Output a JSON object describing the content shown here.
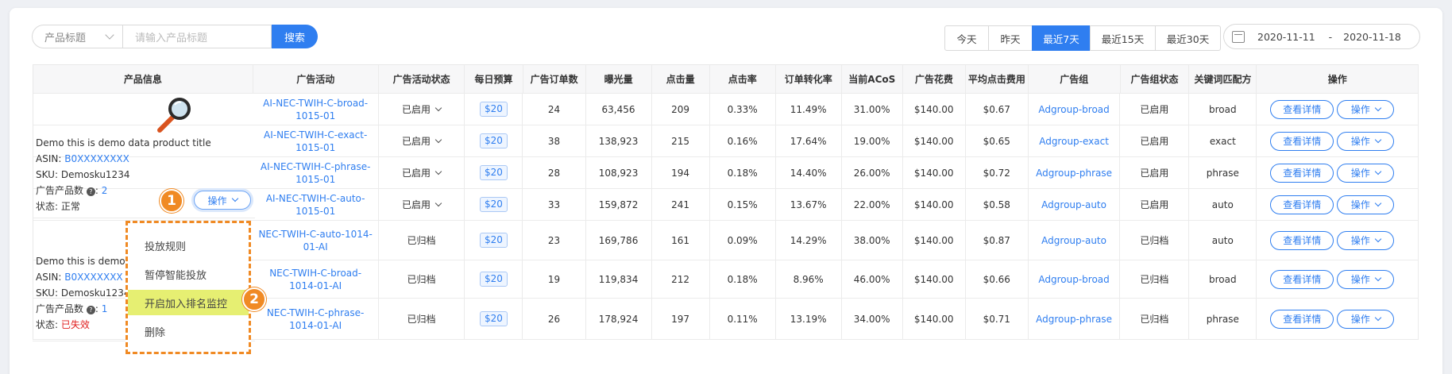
{
  "search": {
    "select_label": "产品标题",
    "input_placeholder": "请输入产品标题",
    "button_label": "搜索"
  },
  "date_tabs": [
    {
      "label": "今天",
      "active": false
    },
    {
      "label": "昨天",
      "active": false
    },
    {
      "label": "最近7天",
      "active": true
    },
    {
      "label": "最近15天",
      "active": false
    },
    {
      "label": "最近30天",
      "active": false
    }
  ],
  "date_range": {
    "start": "2020-11-11",
    "separator": "-",
    "end": "2020-11-18"
  },
  "table": {
    "headers": [
      "产品信息",
      "广告活动",
      "广告活动状态",
      "每日预算",
      "广告订单数",
      "曝光量",
      "点击量",
      "点击率",
      "订单转化率",
      "当前ACoS",
      "广告花费",
      "平均点击费用",
      "广告组",
      "广告组状态",
      "关键词匹配方",
      "操作"
    ],
    "rows": [
      {
        "campaign": "AI-NEC-TWIH-C-broad-1015-01",
        "status": "已启用",
        "status_dropdown": true,
        "budget": "$20",
        "orders": "24",
        "impressions": "63,456",
        "clicks": "209",
        "ctr": "0.33%",
        "cvr": "11.49%",
        "acos": "31.00%",
        "spend": "$140.00",
        "cpc": "$0.67",
        "ad_group": "Adgroup-broad",
        "group_status": "已启用",
        "match": "broad"
      },
      {
        "campaign": "AI-NEC-TWIH-C-exact-1015-01",
        "status": "已启用",
        "status_dropdown": true,
        "budget": "$20",
        "orders": "38",
        "impressions": "138,923",
        "clicks": "215",
        "ctr": "0.16%",
        "cvr": "17.64%",
        "acos": "19.00%",
        "spend": "$140.00",
        "cpc": "$0.65",
        "ad_group": "Adgroup-exact",
        "group_status": "已启用",
        "match": "exact"
      },
      {
        "campaign": "AI-NEC-TWIH-C-phrase-1015-01",
        "status": "已启用",
        "status_dropdown": true,
        "budget": "$20",
        "orders": "28",
        "impressions": "108,923",
        "clicks": "194",
        "ctr": "0.18%",
        "cvr": "14.40%",
        "acos": "26.00%",
        "spend": "$140.00",
        "cpc": "$0.72",
        "ad_group": "Adgroup-phrase",
        "group_status": "已启用",
        "match": "phrase"
      },
      {
        "campaign": "AI-NEC-TWIH-C-auto-1015-01",
        "status": "已启用",
        "status_dropdown": true,
        "budget": "$20",
        "orders": "33",
        "impressions": "159,872",
        "clicks": "241",
        "ctr": "0.15%",
        "cvr": "13.67%",
        "acos": "22.00%",
        "spend": "$140.00",
        "cpc": "$0.58",
        "ad_group": "Adgroup-auto",
        "group_status": "已启用",
        "match": "auto"
      },
      {
        "campaign": "NEC-TWIH-C-auto-1014-01-AI",
        "status": "已归档",
        "status_dropdown": false,
        "budget": "$20",
        "orders": "23",
        "impressions": "169,786",
        "clicks": "161",
        "ctr": "0.09%",
        "cvr": "14.29%",
        "acos": "38.00%",
        "spend": "$140.00",
        "cpc": "$0.87",
        "ad_group": "Adgroup-auto",
        "group_status": "已归档",
        "match": "auto"
      },
      {
        "campaign": "NEC-TWIH-C-broad-1014-01-AI",
        "status": "已归档",
        "status_dropdown": false,
        "budget": "$20",
        "orders": "19",
        "impressions": "119,834",
        "clicks": "212",
        "ctr": "0.18%",
        "cvr": "8.96%",
        "acos": "46.00%",
        "spend": "$140.00",
        "cpc": "$0.66",
        "ad_group": "Adgroup-broad",
        "group_status": "已归档",
        "match": "broad"
      },
      {
        "campaign": "NEC-TWIH-C-phrase-1014-01-AI",
        "status": "已归档",
        "status_dropdown": false,
        "budget": "$20",
        "orders": "26",
        "impressions": "178,924",
        "clicks": "197",
        "ctr": "0.11%",
        "cvr": "13.19%",
        "acos": "34.00%",
        "spend": "$140.00",
        "cpc": "$0.71",
        "ad_group": "Adgroup-phrase",
        "group_status": "已归档",
        "match": "phrase"
      }
    ],
    "detail_label": "查看详情",
    "op_label": "操作"
  },
  "products": [
    {
      "title": "Demo this is demo data product title",
      "asin_label": "ASIN:",
      "asin": "B0XXXXXXXX",
      "sku_label": "SKU:",
      "sku": "Demosku1234",
      "count_label": "广告产品数",
      "count": "2",
      "state_label": "状态:",
      "state": "正常",
      "state_color": "#333333"
    },
    {
      "title": "Demo this is demo d",
      "asin_label": "ASIN:",
      "asin": "B0XXXXXXX",
      "sku_label": "SKU:",
      "sku": "Demosku1234",
      "count_label": "广告产品数",
      "count": "1",
      "state_label": "状态:",
      "state": "已失效",
      "state_color": "#e02020"
    }
  ],
  "product_op_button": "操作",
  "badges": [
    "1",
    "2"
  ],
  "dropdown_menu": [
    {
      "label": "投放规则",
      "highlighted": false
    },
    {
      "label": "暂停智能投放",
      "highlighted": false
    },
    {
      "label": "开启加入排名监控",
      "highlighted": true
    },
    {
      "label": "删除",
      "highlighted": false
    }
  ],
  "colors": {
    "accent": "#2f7ef0",
    "badge": "#f08a24",
    "highlight": "#e6ef72",
    "inactive": "#e02020"
  }
}
